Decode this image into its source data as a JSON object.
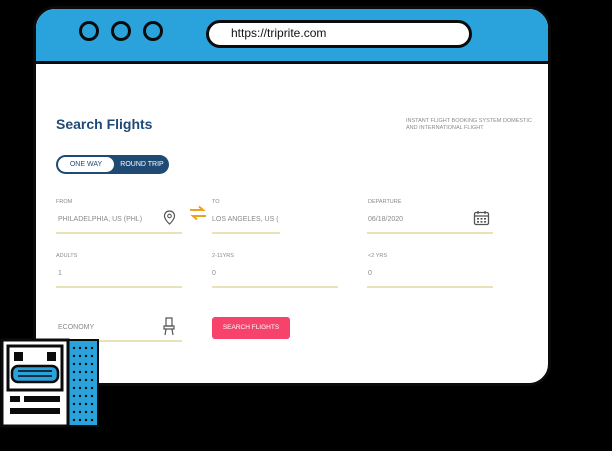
{
  "browser": {
    "url": "https://triprite.com"
  },
  "page": {
    "title": "Search Flights",
    "tagline": "INSTANT FLIGHT BOOKING SYSTEM DOMESTIC AND INTERNATIONAL FLIGHT"
  },
  "trip_type": {
    "one_way": "ONE WAY",
    "round_trip": "ROUND TRIP",
    "selected": "ONE WAY"
  },
  "form": {
    "from": {
      "label": "FROM",
      "value": "PHILADELPHIA, US (PHL)"
    },
    "to": {
      "label": "TO",
      "value": "LOS ANGELES, US ("
    },
    "departure": {
      "label": "DEPARTURE",
      "value": "06/18/2020"
    },
    "adults": {
      "label": "ADULTS",
      "value": "1"
    },
    "children": {
      "label": "2-11YRS",
      "value": "0"
    },
    "infants": {
      "label": "<2 YRS",
      "value": "0"
    },
    "cabin_class": {
      "value": "ECONOMY"
    },
    "search_button": "SEARCH FLIGHTS"
  },
  "colors": {
    "titlebar": "#2aa3dd",
    "brand_navy": "#1f4a74",
    "accent_pink": "#f7426b",
    "swap_orange": "#f0a020",
    "underline": "#e8e3b6"
  },
  "icons": [
    "location-pin-icon",
    "swap-arrows-icon",
    "calendar-icon",
    "seat-icon",
    "robot-mascot-icon"
  ]
}
